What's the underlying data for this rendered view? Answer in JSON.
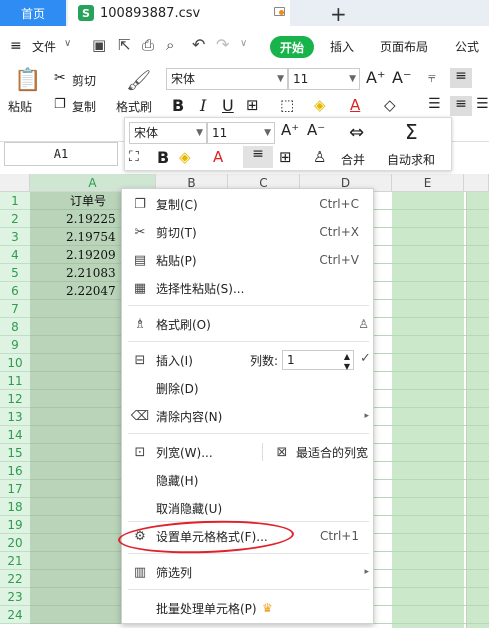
{
  "tabs": {
    "home": "首页",
    "file": "100893887.csv",
    "file_icon": "S",
    "add": "+"
  },
  "menubar": {
    "file_menu": "文件",
    "items": [
      "开始",
      "插入",
      "页面布局",
      "公式"
    ]
  },
  "ribbon": {
    "paste": "粘贴",
    "cut": "剪切",
    "copy": "复制",
    "format_painter": "格式刷",
    "font": "宋体",
    "size": "11"
  },
  "mini": {
    "font": "宋体",
    "size": "11",
    "merge": "合并",
    "autosum": "自动求和"
  },
  "namebox": "A1",
  "columns": [
    "A",
    "B",
    "C",
    "D",
    "E"
  ],
  "rows": [
    "1",
    "2",
    "3",
    "4",
    "5",
    "6",
    "7",
    "8",
    "9",
    "10",
    "11",
    "12",
    "13",
    "14",
    "15",
    "16",
    "17",
    "18",
    "19",
    "20",
    "21",
    "22",
    "23",
    "24"
  ],
  "cells": {
    "A1": "订单号",
    "A2": "2.19225",
    "A3": "2.19754",
    "A4": "2.19209",
    "A5": "2.21083",
    "A6": "2.22047"
  },
  "context_menu": {
    "copy": "复制(C)",
    "copy_sc": "Ctrl+C",
    "cut": "剪切(T)",
    "cut_sc": "Ctrl+X",
    "paste": "粘贴(P)",
    "paste_sc": "Ctrl+V",
    "paste_special": "选择性粘贴(S)...",
    "format_painter": "格式刷(O)",
    "insert": "插入(I)",
    "cols_label": "列数:",
    "cols_value": "1",
    "delete": "删除(D)",
    "clear": "清除内容(N)",
    "col_width": "列宽(W)...",
    "best_fit": "最适合的列宽",
    "hide": "隐藏(H)",
    "unhide": "取消隐藏(U)",
    "format_cells": "设置单元格格式(F)...",
    "format_cells_sc": "Ctrl+1",
    "filter": "筛选列",
    "batch": "批量处理单元格(P)"
  },
  "colors": {
    "accent_green": "#18b34a",
    "tab_blue": "#2f8cf2",
    "highlight": "#e0202a"
  }
}
